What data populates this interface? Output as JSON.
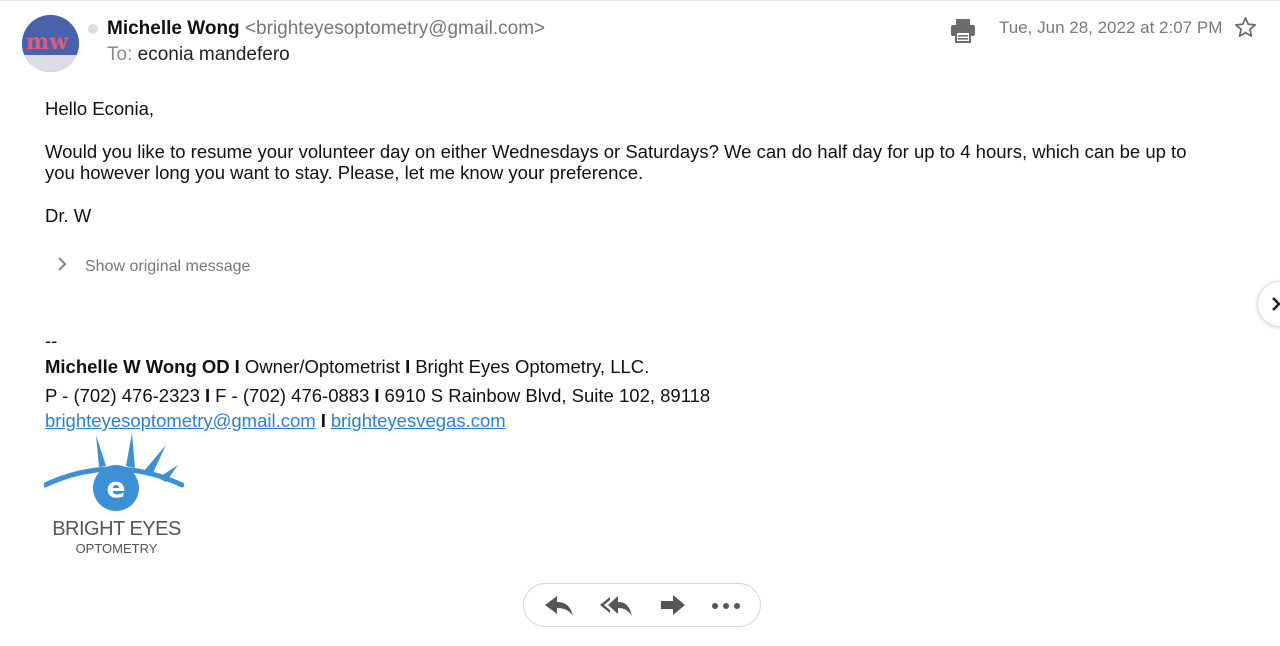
{
  "header": {
    "sender_name": "Michelle Wong",
    "sender_email": "<brighteyesoptometry@gmail.com>",
    "to_label": "To:",
    "to_value": "econia mandefero",
    "date": "Tue, Jun 28, 2022 at 2:07 PM",
    "avatar_initials": "mw"
  },
  "icons": {
    "print": "print-icon",
    "star": "star-icon",
    "next": "chevron-right-icon",
    "show_original": "chevron-right-icon",
    "reply": "reply-icon",
    "reply_all": "reply-all-icon",
    "forward": "forward-icon",
    "more": "more-horizontal-icon"
  },
  "message": {
    "greeting": "Hello Econia,",
    "paragraph": "Would you like to resume your volunteer day on either Wednesdays or Saturdays? We can do half day for up to 4 hours, which can be up to you however long you want to stay. Please, let me know your preference.",
    "closing": "Dr. W",
    "show_original": "Show original message"
  },
  "signature": {
    "dashes": "--",
    "name": "Michelle W Wong OD",
    "title": "Owner/Optometrist",
    "company": "Bright Eyes Optometry, LLC.",
    "phone": "P - (702) 476-2323",
    "fax": "F - (702) 476-0883",
    "address": "6910 S Rainbow Blvd, Suite 102, 89118",
    "email_link": "brighteyesoptometry@gmail.com",
    "web_link": "brighteyesvegas.com",
    "separator": "I",
    "logo_title": "BRIGHT EYES",
    "logo_subtitle": "OPTOMETRY"
  },
  "colors": {
    "link": "#2c7fd3",
    "logo_blue": "#3d8fd6",
    "muted": "#777777"
  }
}
